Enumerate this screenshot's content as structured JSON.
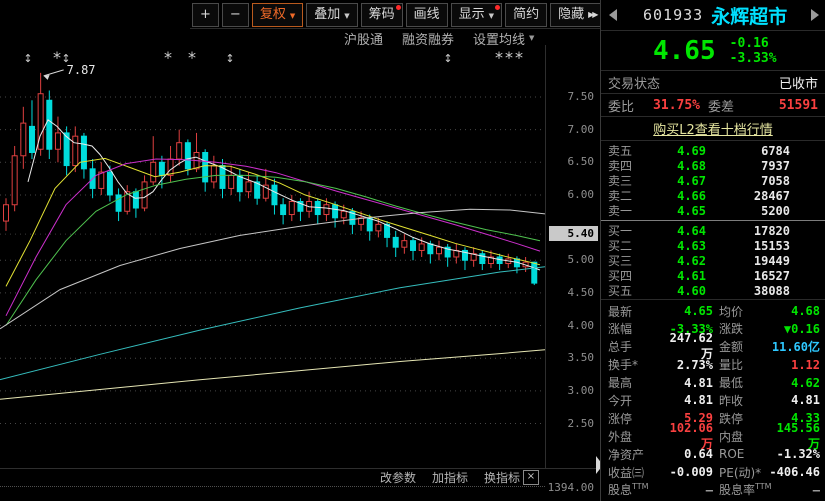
{
  "toolbar": {
    "buttons": [
      {
        "name": "zoom-in-button",
        "label": "+"
      },
      {
        "name": "zoom-out-button",
        "label": "−"
      },
      {
        "name": "adjust-rights-button",
        "label": "复权",
        "caret": true,
        "accent": true
      },
      {
        "name": "overlay-button",
        "label": "叠加",
        "caret": true
      },
      {
        "name": "chips-button",
        "label": "筹码",
        "dot": true
      },
      {
        "name": "draw-line-button",
        "label": "画线"
      },
      {
        "name": "display-button",
        "label": "显示",
        "caret": true,
        "dot": true
      },
      {
        "name": "simple-mode-button",
        "label": "简约"
      },
      {
        "name": "hide-button",
        "label": "隐藏",
        "dbl": "▶▶"
      },
      {
        "name": "fullscreen-button",
        "label": "",
        "fullscreen": true
      }
    ],
    "submenu": [
      {
        "name": "submenu-hugutong",
        "label": "沪股通"
      },
      {
        "name": "submenu-margin-trading",
        "label": "融资融券"
      },
      {
        "name": "submenu-ma-settings",
        "label": "设置均线",
        "caret": true
      }
    ]
  },
  "footer": {
    "links": [
      "改参数",
      "加指标",
      "换指标"
    ],
    "close": "×"
  },
  "chart_data": {
    "type": "candlestick",
    "title": "601933 永辉超市 K线",
    "ylim": [
      2.5,
      7.5
    ],
    "grid": "dotted horizontal at 0.5 steps",
    "price_axis_labels": [
      7.5,
      7.0,
      6.5,
      6.0,
      5.0,
      4.5,
      4.0,
      3.5,
      3.0,
      2.5
    ],
    "axis_highlight_label": "5.40",
    "axis_highlight_price": 5.4,
    "volume_axis_label": "1394.00",
    "annotation": {
      "text": "7.87",
      "bar": 4,
      "price": 7.87
    },
    "event_markers": [
      {
        "x": 28,
        "glyph": "updown"
      },
      {
        "x": 57,
        "glyph": "star"
      },
      {
        "x": 66,
        "glyph": "updown"
      },
      {
        "x": 168,
        "glyph": "star"
      },
      {
        "x": 192,
        "glyph": "star"
      },
      {
        "x": 230,
        "glyph": "updown"
      },
      {
        "x": 448,
        "glyph": "updown"
      },
      {
        "x": 499,
        "glyph": "star"
      },
      {
        "x": 509,
        "glyph": "star"
      },
      {
        "x": 519,
        "glyph": "star"
      }
    ],
    "candles": [
      [
        5.6,
        5.95,
        5.45,
        5.85
      ],
      [
        5.85,
        6.75,
        5.75,
        6.6
      ],
      [
        6.6,
        7.35,
        6.4,
        7.1
      ],
      [
        7.05,
        7.45,
        6.55,
        6.65
      ],
      [
        6.7,
        7.87,
        6.6,
        7.55
      ],
      [
        7.45,
        7.6,
        6.55,
        6.7
      ],
      [
        6.7,
        7.2,
        6.5,
        6.95
      ],
      [
        6.95,
        7.05,
        6.3,
        6.45
      ],
      [
        6.45,
        7.05,
        6.35,
        6.9
      ],
      [
        6.9,
        6.95,
        6.25,
        6.4
      ],
      [
        6.4,
        6.55,
        5.95,
        6.1
      ],
      [
        6.1,
        6.5,
        6.0,
        6.35
      ],
      [
        6.35,
        6.45,
        5.9,
        6.0
      ],
      [
        6.0,
        6.1,
        5.6,
        5.75
      ],
      [
        5.75,
        6.15,
        5.7,
        6.05
      ],
      [
        6.05,
        6.1,
        5.65,
        5.8
      ],
      [
        5.8,
        6.3,
        5.75,
        6.2
      ],
      [
        6.2,
        6.9,
        6.15,
        6.5
      ],
      [
        6.5,
        6.6,
        6.1,
        6.3
      ],
      [
        6.3,
        6.75,
        6.2,
        6.55
      ],
      [
        6.55,
        7.0,
        6.45,
        6.8
      ],
      [
        6.8,
        6.85,
        6.3,
        6.4
      ],
      [
        6.4,
        6.95,
        6.35,
        6.65
      ],
      [
        6.65,
        6.7,
        6.05,
        6.2
      ],
      [
        6.2,
        6.6,
        6.1,
        6.45
      ],
      [
        6.45,
        6.55,
        5.95,
        6.1
      ],
      [
        6.1,
        6.45,
        6.0,
        6.3
      ],
      [
        6.3,
        6.4,
        5.9,
        6.05
      ],
      [
        6.05,
        6.35,
        5.95,
        6.2
      ],
      [
        6.2,
        6.3,
        5.85,
        5.95
      ],
      [
        5.95,
        6.4,
        5.9,
        6.15
      ],
      [
        6.15,
        6.25,
        5.7,
        5.85
      ],
      [
        5.85,
        5.95,
        5.55,
        5.7
      ],
      [
        5.7,
        6.0,
        5.6,
        5.9
      ],
      [
        5.9,
        5.95,
        5.6,
        5.75
      ],
      [
        5.75,
        6.05,
        5.65,
        5.9
      ],
      [
        5.9,
        5.95,
        5.55,
        5.7
      ],
      [
        5.7,
        5.95,
        5.6,
        5.85
      ],
      [
        5.85,
        5.9,
        5.5,
        5.65
      ],
      [
        5.65,
        5.85,
        5.55,
        5.75
      ],
      [
        5.75,
        5.8,
        5.4,
        5.55
      ],
      [
        5.55,
        5.75,
        5.45,
        5.65
      ],
      [
        5.65,
        5.7,
        5.3,
        5.45
      ],
      [
        5.45,
        5.65,
        5.35,
        5.55
      ],
      [
        5.55,
        5.6,
        5.2,
        5.35
      ],
      [
        5.35,
        5.45,
        5.05,
        5.2
      ],
      [
        5.2,
        5.4,
        5.1,
        5.3
      ],
      [
        5.3,
        5.35,
        5.0,
        5.15
      ],
      [
        5.15,
        5.35,
        5.05,
        5.25
      ],
      [
        5.25,
        5.3,
        4.95,
        5.1
      ],
      [
        5.1,
        5.3,
        5.0,
        5.2
      ],
      [
        5.2,
        5.25,
        4.9,
        5.05
      ],
      [
        5.05,
        5.25,
        4.95,
        5.15
      ],
      [
        5.15,
        5.2,
        4.85,
        5.0
      ],
      [
        5.0,
        5.2,
        4.9,
        5.1
      ],
      [
        5.1,
        5.15,
        4.85,
        4.95
      ],
      [
        4.95,
        5.15,
        4.88,
        5.05
      ],
      [
        5.05,
        5.1,
        4.85,
        4.95
      ],
      [
        4.95,
        5.1,
        4.88,
        5.02
      ],
      [
        5.02,
        5.06,
        4.8,
        4.9
      ],
      [
        4.9,
        5.05,
        4.82,
        4.97
      ],
      [
        4.97,
        4.98,
        4.62,
        4.65
      ]
    ],
    "ma_lines": [
      {
        "name": "MA5",
        "color": "#ebebeb",
        "points": [
          [
            28,
            6.2
          ],
          [
            40,
            6.9
          ],
          [
            48,
            7.15
          ],
          [
            57,
            7.05
          ],
          [
            66,
            6.9
          ],
          [
            74,
            6.8
          ],
          [
            83,
            6.78
          ],
          [
            92,
            6.75
          ],
          [
            100,
            6.62
          ],
          [
            109,
            6.42
          ],
          [
            118,
            6.2
          ],
          [
            127,
            6.02
          ],
          [
            135,
            5.95
          ],
          [
            144,
            5.96
          ],
          [
            153,
            6.05
          ],
          [
            161,
            6.22
          ],
          [
            170,
            6.38
          ],
          [
            179,
            6.48
          ],
          [
            187,
            6.55
          ],
          [
            196,
            6.58
          ],
          [
            205,
            6.52
          ],
          [
            222,
            6.42
          ],
          [
            240,
            6.28
          ],
          [
            257,
            6.18
          ],
          [
            274,
            6.05
          ],
          [
            292,
            5.92
          ],
          [
            309,
            5.82
          ],
          [
            326,
            5.8
          ],
          [
            344,
            5.76
          ],
          [
            361,
            5.68
          ],
          [
            378,
            5.6
          ],
          [
            396,
            5.48
          ],
          [
            413,
            5.35
          ],
          [
            430,
            5.25
          ],
          [
            448,
            5.17
          ],
          [
            465,
            5.12
          ],
          [
            483,
            5.06
          ],
          [
            500,
            5.01
          ],
          [
            517,
            4.97
          ],
          [
            535,
            4.88
          ],
          [
            540,
            4.85
          ]
        ]
      },
      {
        "name": "MA10",
        "color": "#e2e233",
        "points": [
          [
            6,
            4.6
          ],
          [
            30,
            5.3
          ],
          [
            55,
            6.1
          ],
          [
            80,
            6.5
          ],
          [
            105,
            6.56
          ],
          [
            130,
            6.42
          ],
          [
            155,
            6.28
          ],
          [
            180,
            6.35
          ],
          [
            205,
            6.45
          ],
          [
            230,
            6.44
          ],
          [
            255,
            6.32
          ],
          [
            280,
            6.18
          ],
          [
            305,
            6.0
          ],
          [
            330,
            5.88
          ],
          [
            355,
            5.75
          ],
          [
            380,
            5.62
          ],
          [
            405,
            5.5
          ],
          [
            430,
            5.38
          ],
          [
            455,
            5.26
          ],
          [
            480,
            5.16
          ],
          [
            505,
            5.06
          ],
          [
            530,
            4.97
          ],
          [
            540,
            4.93
          ]
        ]
      },
      {
        "name": "MA20",
        "color": "#cc2fcc",
        "points": [
          [
            6,
            4.15
          ],
          [
            36,
            5.05
          ],
          [
            66,
            5.85
          ],
          [
            96,
            6.3
          ],
          [
            126,
            6.48
          ],
          [
            156,
            6.55
          ],
          [
            186,
            6.54
          ],
          [
            216,
            6.5
          ],
          [
            246,
            6.44
          ],
          [
            276,
            6.34
          ],
          [
            306,
            6.2
          ],
          [
            336,
            6.06
          ],
          [
            366,
            5.93
          ],
          [
            396,
            5.8
          ],
          [
            426,
            5.67
          ],
          [
            456,
            5.54
          ],
          [
            486,
            5.4
          ],
          [
            516,
            5.26
          ],
          [
            540,
            5.14
          ]
        ]
      },
      {
        "name": "MA30",
        "color": "#4fc24f",
        "points": [
          [
            6,
            4.0
          ],
          [
            36,
            4.7
          ],
          [
            66,
            5.3
          ],
          [
            96,
            5.75
          ],
          [
            126,
            6.0
          ],
          [
            156,
            6.15
          ],
          [
            186,
            6.24
          ],
          [
            216,
            6.3
          ],
          [
            246,
            6.3
          ],
          [
            276,
            6.27
          ],
          [
            306,
            6.2
          ],
          [
            336,
            6.1
          ],
          [
            366,
            5.97
          ],
          [
            396,
            5.83
          ],
          [
            426,
            5.7
          ],
          [
            456,
            5.58
          ],
          [
            486,
            5.47
          ],
          [
            516,
            5.38
          ],
          [
            540,
            5.3
          ]
        ]
      },
      {
        "name": "MA60",
        "color": "#c6c6c6",
        "points": [
          [
            0,
            3.95
          ],
          [
            60,
            4.55
          ],
          [
            120,
            4.92
          ],
          [
            180,
            5.18
          ],
          [
            240,
            5.38
          ],
          [
            300,
            5.52
          ],
          [
            360,
            5.64
          ],
          [
            420,
            5.73
          ],
          [
            470,
            5.78
          ],
          [
            510,
            5.77
          ],
          [
            545,
            5.71
          ]
        ]
      },
      {
        "name": "MA120",
        "color": "#35bdbd",
        "points": [
          [
            0,
            3.17
          ],
          [
            100,
            3.56
          ],
          [
            200,
            3.93
          ],
          [
            300,
            4.27
          ],
          [
            400,
            4.58
          ],
          [
            500,
            4.82
          ],
          [
            545,
            4.9
          ]
        ]
      },
      {
        "name": "MA250",
        "color": "#e6e6b4",
        "points": [
          [
            0,
            2.87
          ],
          [
            100,
            3.02
          ],
          [
            200,
            3.17
          ],
          [
            300,
            3.31
          ],
          [
            400,
            3.45
          ],
          [
            500,
            3.57
          ],
          [
            545,
            3.63
          ]
        ]
      }
    ],
    "colors": {
      "up": "#e04040",
      "down": "#00dcdc"
    }
  },
  "right_panel": {
    "header": {
      "code": "601933",
      "name": "永辉超市"
    },
    "price": {
      "last": "4.65",
      "change": "-0.16",
      "pct": "-3.33%"
    },
    "status": {
      "label": "交易状态",
      "value": "已收市"
    },
    "weibi": {
      "label": "委比",
      "value": "31.75%",
      "label2": "委差",
      "value2": "51591"
    },
    "l2_link": "购买L2查看十档行情",
    "order_book": {
      "sell": [
        [
          "卖五",
          "4.69",
          "6784"
        ],
        [
          "卖四",
          "4.68",
          "7937"
        ],
        [
          "卖三",
          "4.67",
          "7058"
        ],
        [
          "卖二",
          "4.66",
          "28467"
        ],
        [
          "卖一",
          "4.65",
          "5200"
        ]
      ],
      "buy": [
        [
          "买一",
          "4.64",
          "17820"
        ],
        [
          "买二",
          "4.63",
          "15153"
        ],
        [
          "买三",
          "4.62",
          "19449"
        ],
        [
          "买四",
          "4.61",
          "16527"
        ],
        [
          "买五",
          "4.60",
          "38088"
        ]
      ]
    },
    "stats": [
      {
        "l": "最新",
        "v": "4.65",
        "vc": "c-green",
        "l2": "均价",
        "v2": "4.68",
        "v2c": "c-green"
      },
      {
        "l": "涨幅",
        "v": "-3.33%",
        "vc": "c-green",
        "l2": "涨跌",
        "v2": "▼0.16",
        "v2c": "c-green"
      },
      {
        "l": "总手",
        "v": "247.62万",
        "vc": "c-white",
        "l2": "金额",
        "v2": "11.60亿",
        "v2c": "c-blue"
      },
      {
        "l": "换手*",
        "v": "2.73%",
        "vc": "c-white",
        "l2": "量比",
        "v2": "1.12",
        "v2c": "c-red"
      },
      {
        "l": "最高",
        "v": "4.81",
        "vc": "c-white",
        "l2": "最低",
        "v2": "4.62",
        "v2c": "c-green"
      },
      {
        "l": "今开",
        "v": "4.81",
        "vc": "c-white",
        "l2": "昨收",
        "v2": "4.81",
        "v2c": "c-white"
      },
      {
        "l": "涨停",
        "v": "5.29",
        "vc": "c-red",
        "l2": "跌停",
        "v2": "4.33",
        "v2c": "c-green"
      },
      {
        "l": "外盘",
        "v": "102.06万",
        "vc": "c-red",
        "l2": "内盘",
        "v2": "145.56万",
        "v2c": "c-green"
      },
      {
        "l": "净资产",
        "v": "0.64",
        "vc": "c-white",
        "l2": "ROE",
        "v2": "-1.32%",
        "v2c": "c-white"
      },
      {
        "l": "收益㈢",
        "v": "-0.009",
        "vc": "c-white",
        "l2": "PE(动)*",
        "v2": "-406.46",
        "v2c": "c-white"
      },
      {
        "l": "股息",
        "lsup": "TTM",
        "v": "—",
        "vc": "c-gray",
        "l2": "股息率",
        "l2sup": "TTM",
        "v2": "—",
        "v2c": "c-gray"
      }
    ]
  }
}
